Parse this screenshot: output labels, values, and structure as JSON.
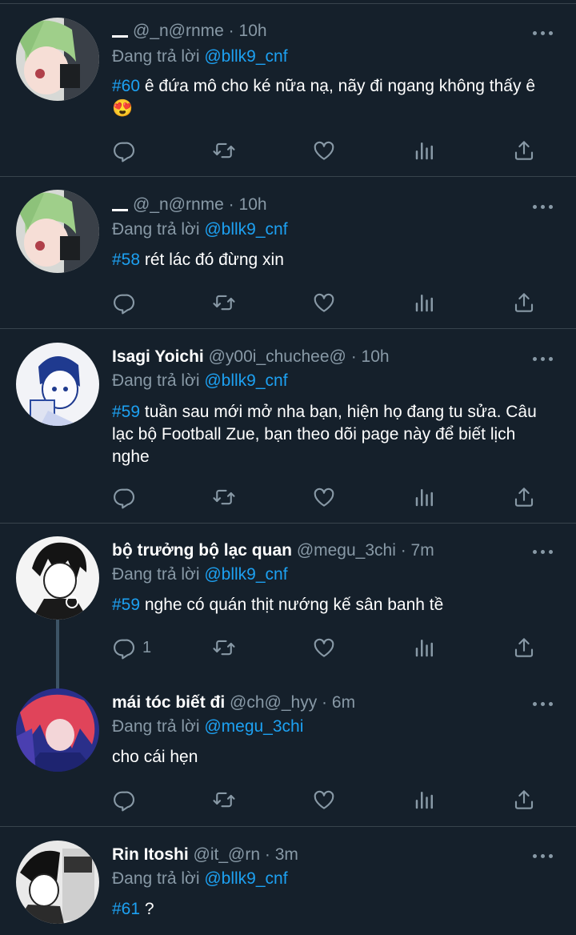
{
  "tweets": [
    {
      "name": "",
      "handle": "@_n@rnme",
      "time": "10h",
      "reply_prefix": "Đang trả lời",
      "reply_to": "@bllk9_cnf",
      "tag": "#60",
      "text": " ê đứa mô cho ké nữa nạ, nãy đi ngang không thấy ê😍",
      "reply_count": ""
    },
    {
      "name": "",
      "handle": "@_n@rnme",
      "time": "10h",
      "reply_prefix": "Đang trả lời",
      "reply_to": "@bllk9_cnf",
      "tag": "#58",
      "text": " rét lác đó đừng xin",
      "reply_count": ""
    },
    {
      "name": "Isagi Yoichi",
      "handle": "@y00i_chuchee@",
      "time": "10h",
      "reply_prefix": "Đang trả lời",
      "reply_to": "@bllk9_cnf",
      "tag": "#59",
      "text": " tuần sau mới mở nha bạn, hiện họ đang tu sửa. Câu lạc bộ Football Zue, bạn theo dõi page này để biết lịch nghe",
      "reply_count": ""
    },
    {
      "name": "bộ trưởng bộ lạc quan",
      "handle": "@megu_3chi",
      "time": "7m",
      "reply_prefix": "Đang trả lời",
      "reply_to": "@bllk9_cnf",
      "tag": "#59",
      "text": " nghe có quán thịt nướng kế sân banh tề",
      "reply_count": "1"
    },
    {
      "name": "mái tóc biết đi",
      "handle": "@ch@_hyy",
      "time": "6m",
      "reply_prefix": "Đang trả lời",
      "reply_to": "@megu_3chi",
      "tag": "",
      "text": "cho cái hẹn",
      "reply_count": ""
    },
    {
      "name": "Rin Itoshi",
      "handle": "@it_@rn",
      "time": "3m",
      "reply_prefix": "Đang trả lời",
      "reply_to": "@bllk9_cnf",
      "tag": "#61",
      "text": " ?",
      "reply_count": ""
    }
  ],
  "theme": {
    "background": "#15202b",
    "text": "#ffffff",
    "muted": "#8899a6",
    "accent": "#1da1f2",
    "divider": "#38444d"
  },
  "icons": [
    "reply-icon",
    "retweet-icon",
    "like-icon",
    "analytics-icon",
    "share-icon",
    "more-icon"
  ]
}
